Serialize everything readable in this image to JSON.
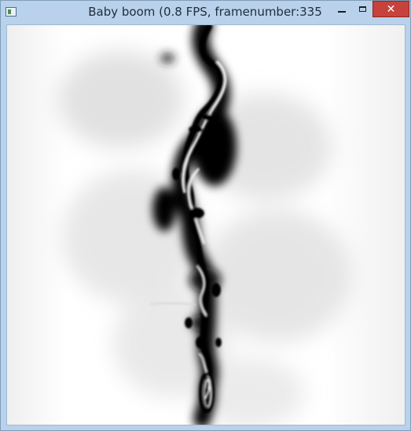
{
  "window": {
    "title": "Baby boom (0.8 FPS, framenumber:335",
    "icons": {
      "app": "application-icon",
      "minimize": "minimize-icon",
      "maximize": "maximize-icon",
      "close": "close-icon"
    }
  },
  "colors": {
    "titlebar": "#b9d1ea",
    "close_button": "#c7423c",
    "canvas_bg": "#ffffff",
    "plume": "#000000"
  }
}
